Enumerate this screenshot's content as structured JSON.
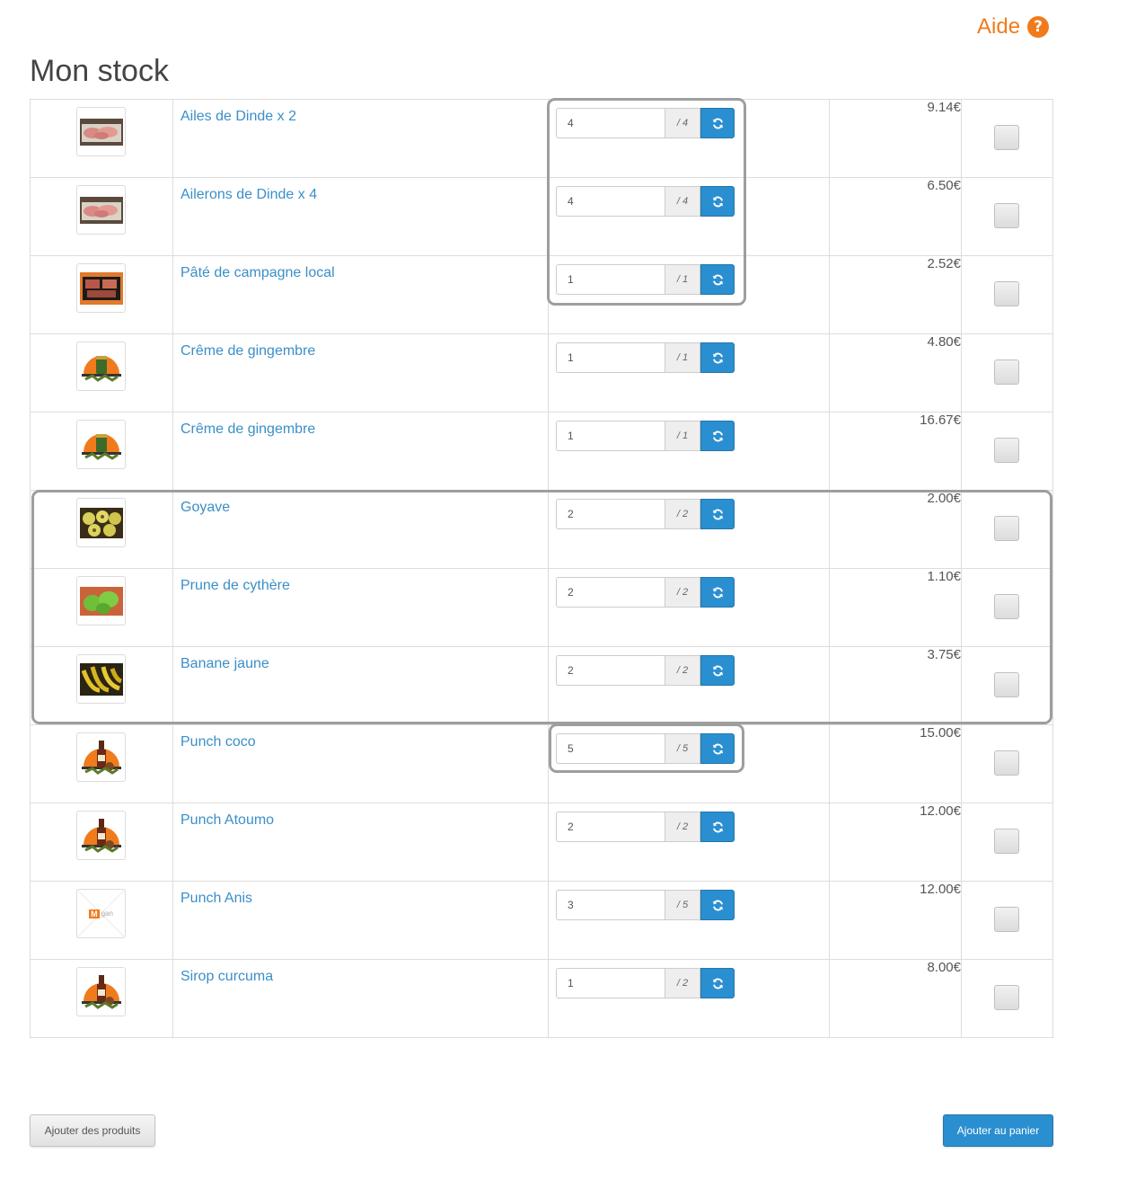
{
  "help": {
    "label": "Aide",
    "icon": "question-circle-icon",
    "color": "#f07b1d"
  },
  "page_title": "Mon stock",
  "accent_color": "#2a8fd0",
  "link_color": "#3a8fc7",
  "products": [
    {
      "name": "Ailes de Dinde x 2",
      "quantity": "4",
      "max": "/ 4",
      "price": "9.14€",
      "image": "poultry-meat"
    },
    {
      "name": "Ailerons de Dinde x 4",
      "quantity": "4",
      "max": "/ 4",
      "price": "6.50€",
      "image": "poultry-meat"
    },
    {
      "name": "Pâté de campagne local",
      "quantity": "1",
      "max": "/ 1",
      "price": "2.52€",
      "image": "pate-tray"
    },
    {
      "name": "Crême de gingembre",
      "quantity": "1",
      "max": "/ 1",
      "price": "4.80€",
      "image": "brand-jar"
    },
    {
      "name": "Crême de gingembre",
      "quantity": "1",
      "max": "/ 1",
      "price": "16.67€",
      "image": "brand-jar"
    },
    {
      "name": "Goyave",
      "quantity": "2",
      "max": "/ 2",
      "price": "2.00€",
      "image": "guava-fruit"
    },
    {
      "name": "Prune de cythère",
      "quantity": "2",
      "max": "/ 2",
      "price": "1.10€",
      "image": "green-plum"
    },
    {
      "name": "Banane jaune",
      "quantity": "2",
      "max": "/ 2",
      "price": "3.75€",
      "image": "banana-bunch"
    },
    {
      "name": "Punch coco",
      "quantity": "5",
      "max": "/ 5",
      "price": "15.00€",
      "image": "brand-bottle"
    },
    {
      "name": "Punch Atoumo",
      "quantity": "2",
      "max": "/ 2",
      "price": "12.00€",
      "image": "brand-bottle"
    },
    {
      "name": "Punch Anis",
      "quantity": "3",
      "max": "/ 5",
      "price": "12.00€",
      "image": "placeholder-logo",
      "placeholder_text": "gan"
    },
    {
      "name": "Sirop curcuma",
      "quantity": "1",
      "max": "/ 2",
      "price": "8.00€",
      "image": "brand-bottle"
    }
  ],
  "buttons": {
    "add_products": "Ajouter des produits",
    "add_to_cart": "Ajouter au panier"
  }
}
